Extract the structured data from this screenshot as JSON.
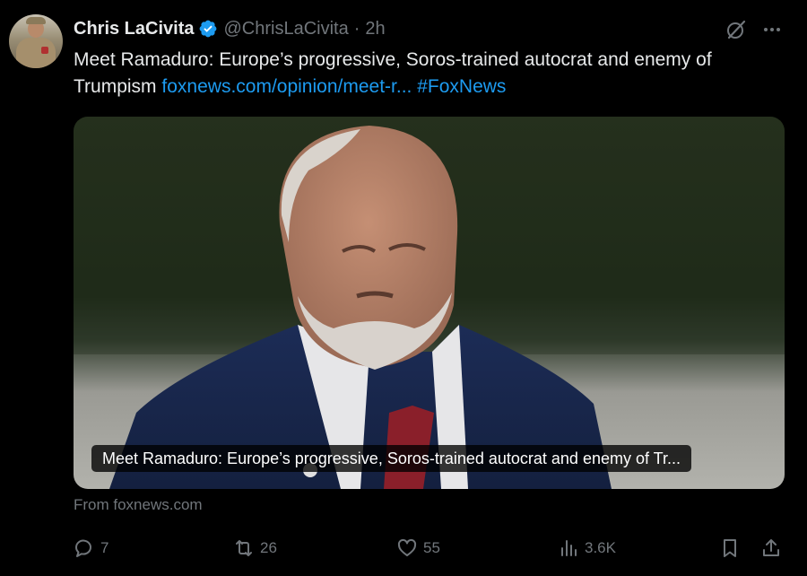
{
  "tweet": {
    "author_name": "Chris LaCivita",
    "handle": "@ChrisLaCivita",
    "separator": "·",
    "time": "2h",
    "text": "Meet Ramaduro: Europe’s progressive, Soros-trained autocrat and enemy of Trumpism",
    "link_text": "foxnews.com/opinion/meet-r...",
    "hashtag": "#FoxNews"
  },
  "card": {
    "caption": "Meet Ramaduro: Europe’s progressive, Soros-trained autocrat and enemy of Tr...",
    "source": "From foxnews.com"
  },
  "actions": {
    "replies": "7",
    "reposts": "26",
    "likes": "55",
    "views": "3.6K"
  },
  "icons": {
    "verified": "verified-badge-icon",
    "grok": "grok-icon",
    "more": "more-icon",
    "reply": "reply-icon",
    "repost": "repost-icon",
    "like": "like-icon",
    "views": "views-icon",
    "bookmark": "bookmark-icon",
    "share": "share-icon"
  },
  "colors": {
    "background": "#000000",
    "text": "#e7e9ea",
    "secondary": "#71767b",
    "link": "#1d9bf0"
  }
}
